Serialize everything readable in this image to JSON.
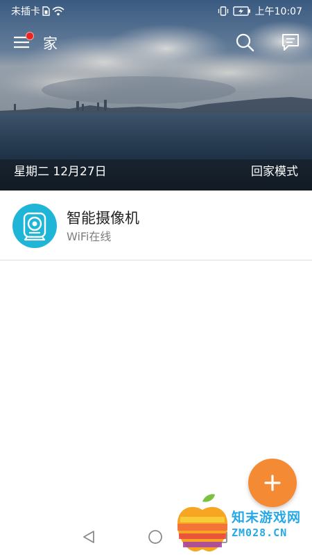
{
  "status_bar": {
    "carrier": "未插卡",
    "time": "上午10:07",
    "icons": [
      "sim-icon",
      "wifi-icon",
      "vibrate-icon",
      "battery-charging-icon"
    ]
  },
  "toolbar": {
    "home_title": "家",
    "has_notification_dot": true,
    "icons": [
      "menu-icon",
      "search-icon",
      "message-icon"
    ]
  },
  "hero": {
    "date": "星期二 12月27日",
    "mode": "回家模式"
  },
  "devices": [
    {
      "name": "智能摄像机",
      "status": "WiFi在线",
      "icon": "camera-icon"
    }
  ],
  "fab": {
    "icon": "plus-icon",
    "color": "#f58a35"
  },
  "nav_bar": {
    "icons": [
      "back-icon",
      "home-icon",
      "recent-apps-icon"
    ]
  },
  "watermark": {
    "line1": "知末游戏网",
    "line2": "ZM028.CN"
  },
  "colors": {
    "accent": "#f58a35",
    "device_icon_bg": "#1fb5d6",
    "notification_dot": "#e8261f"
  }
}
